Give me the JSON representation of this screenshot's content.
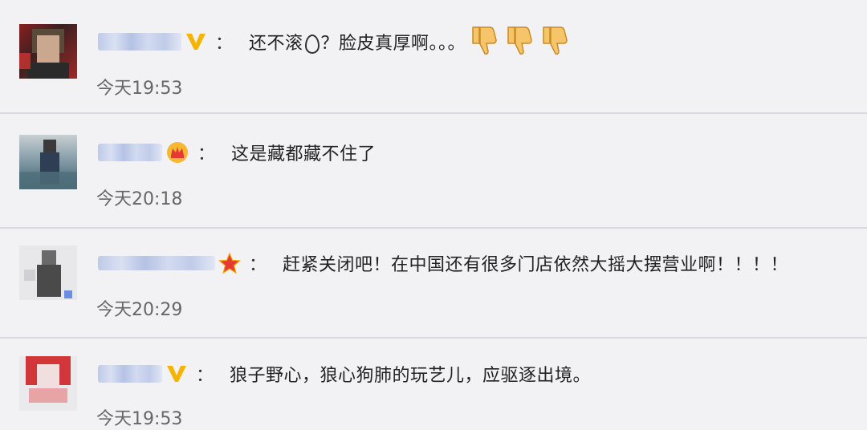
{
  "comments": [
    {
      "text_before": "还不滚",
      "text_after": "？脸皮真厚啊。。。",
      "time": "今天19:53",
      "badge": "verified-v-gold",
      "emoji": [
        "thumbs-down-icon",
        "thumbs-down-icon",
        "thumbs-down-icon"
      ]
    },
    {
      "text": "这是藏都藏不住了",
      "time": "今天20:18",
      "badge": "crown-icon"
    },
    {
      "text": "赶紧关闭吧！在中国还有很多门店依然大摇大摆营业啊！！！！",
      "time": "今天20:29",
      "badge": "red-star-icon"
    },
    {
      "text": "狼子野心，狼心狗肺的玩艺儿，应驱逐出境。",
      "time": "今天19:53",
      "badge": "verified-v-gold"
    }
  ],
  "colon": "：",
  "colors": {
    "background": "#f2f2f5",
    "divider": "#d9d9de",
    "text": "#222222",
    "time": "#666666",
    "badge_gold": "#f5b400"
  }
}
